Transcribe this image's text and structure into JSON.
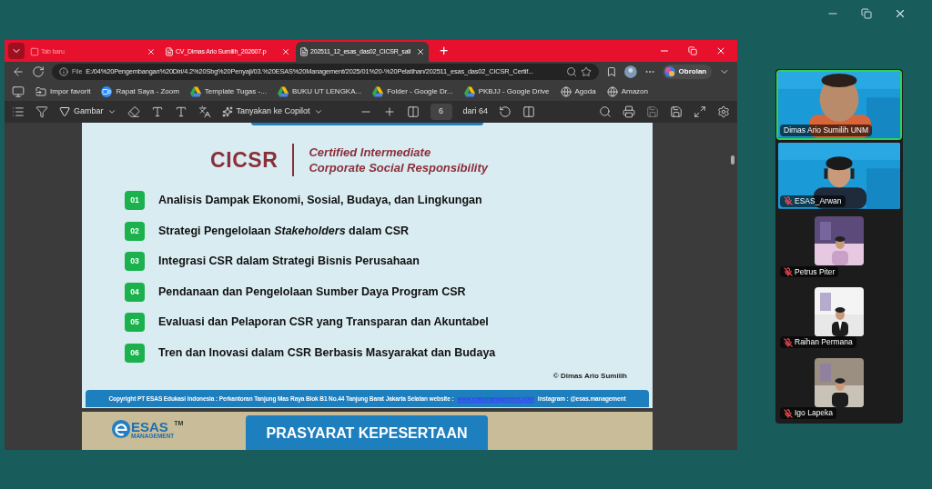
{
  "browser": {
    "tabs": [
      {
        "title": "Tab baru",
        "selected": false,
        "kind": "new"
      },
      {
        "title": "CV_Dimas Ario Sumilih_202607.p",
        "selected": false,
        "kind": "pdf"
      },
      {
        "title": "202511_12_esas_das02_CICSR_sali",
        "selected": true,
        "kind": "pdf"
      }
    ],
    "new_tab": "+",
    "address": {
      "scheme": "File",
      "url": "E:/04%20Pengembangan%20Diri/4.2%20Sbg%20Penyaji/03.%20ESAS%20Management/2025/01%20-%20Pelatihan/202511_esas_das02_CICSR_Certif..."
    },
    "chat_button": "Obrolan",
    "bookmarks": [
      {
        "title": "Impor favorit",
        "kind": "import"
      },
      {
        "title": "Rapat Saya - Zoom",
        "kind": "zoom"
      },
      {
        "title": "Template Tugas -...",
        "kind": "drive"
      },
      {
        "title": "BUKU UT LENGKA...",
        "kind": "drive"
      },
      {
        "title": "Folder - Google Dr...",
        "kind": "drive"
      },
      {
        "title": "PKBJJ - Google Drive",
        "kind": "drive"
      },
      {
        "title": "Agoda",
        "kind": "globe"
      },
      {
        "title": "Amazon",
        "kind": "globe"
      }
    ],
    "pdf_toolbar": {
      "draw": "Gambar",
      "copilot": "Tanyakan ke Copilot",
      "page": "6",
      "page_total": "dari 64"
    }
  },
  "slide": {
    "title": "CICSR",
    "subtitle": [
      "Certified Intermediate",
      "Corporate Social Responsibility"
    ],
    "items": [
      {
        "number": "01",
        "text": "Analisis Dampak Ekonomi, Sosial, Budaya, dan Lingkungan"
      },
      {
        "number": "02",
        "text": "Strategi Pengelolaan *Stakeholders* dalam CSR"
      },
      {
        "number": "03",
        "text": "Integrasi CSR dalam Strategi Bisnis Perusahaan"
      },
      {
        "number": "04",
        "text": "Pendanaan dan Pengelolaan Sumber Daya Program CSR"
      },
      {
        "number": "05",
        "text": "Evaluasi dan Pelaporan CSR yang Transparan dan Akuntabel"
      },
      {
        "number": "06",
        "text": "Tren dan Inovasi dalam CSR Berbasis Masyarakat dan Budaya"
      }
    ],
    "author": "© Dimas Ario Sumilih",
    "footer": {
      "text": "Copyright PT ESAS Edukasi Indonesia : Perkantoran Tanjung Mas Raya Blok B1 No.44 Tanjung Barat Jakarta Selatan website :",
      "link": "www.esasmanagement.com",
      "instagram": "Instagram : @esas.management"
    }
  },
  "next_slide": {
    "logo": "ESAS",
    "trademark": "TM",
    "logo_sub": "MANAGEMENT",
    "banner": "PRASYARAT KEPESERTAAN"
  },
  "participants": [
    {
      "name": "Dimas Ario Sumilih UNM",
      "active": true,
      "muted": false,
      "kind": "video"
    },
    {
      "name": "ESAS_Arwan",
      "active": false,
      "muted": true,
      "kind": "video"
    },
    {
      "name": "Petrus Piter",
      "active": false,
      "muted": true
    },
    {
      "name": "Raihan Permana",
      "active": false,
      "muted": true
    },
    {
      "name": "Igo Lapeka",
      "active": false,
      "muted": true
    }
  ]
}
